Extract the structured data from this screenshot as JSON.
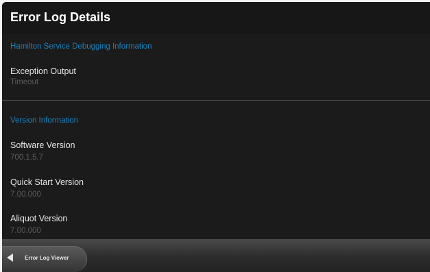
{
  "header": {
    "title": "Error Log Details"
  },
  "debug_section": {
    "heading": "Hamilton Service Debugging Information",
    "fields": [
      {
        "label": "Exception Output",
        "value": "Timeout"
      }
    ]
  },
  "version_section": {
    "heading": "Version Information",
    "fields": [
      {
        "label": "Software Version",
        "value": "700.1.5.7"
      },
      {
        "label": "Quick Start Version",
        "value": "7.00.000"
      },
      {
        "label": "Aliquot Version",
        "value": "7.00.000"
      }
    ]
  },
  "footer": {
    "back_label": "Error Log Viewer",
    "back_icon": "back-arrow-icon"
  },
  "colors": {
    "background": "#1b1b1b",
    "section_heading": "#1e7fb8",
    "label": "#e6e6e6",
    "value": "#5a5a5a"
  }
}
